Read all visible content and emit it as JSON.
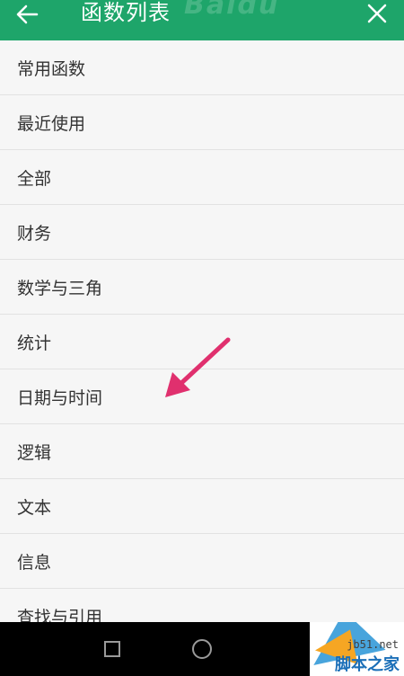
{
  "header": {
    "title": "函数列表",
    "watermark": "Baidu",
    "back_icon": "arrow-left-icon",
    "close_icon": "close-icon",
    "color": "#1ea56a"
  },
  "list": {
    "items": [
      {
        "label": "常用函数"
      },
      {
        "label": "最近使用"
      },
      {
        "label": "全部"
      },
      {
        "label": "财务"
      },
      {
        "label": "数学与三角"
      },
      {
        "label": "统计"
      },
      {
        "label": "日期与时间"
      },
      {
        "label": "逻辑"
      },
      {
        "label": "文本"
      },
      {
        "label": "信息"
      },
      {
        "label": "查找与引用"
      }
    ]
  },
  "annotation": {
    "icon": "arrow-pointer-icon",
    "color": "#e0306e"
  },
  "nav_bar": {
    "buttons": [
      "recent-apps-icon",
      "home-icon"
    ]
  },
  "brand_watermark": {
    "url": "jb51.net",
    "name": "脚本之家"
  }
}
